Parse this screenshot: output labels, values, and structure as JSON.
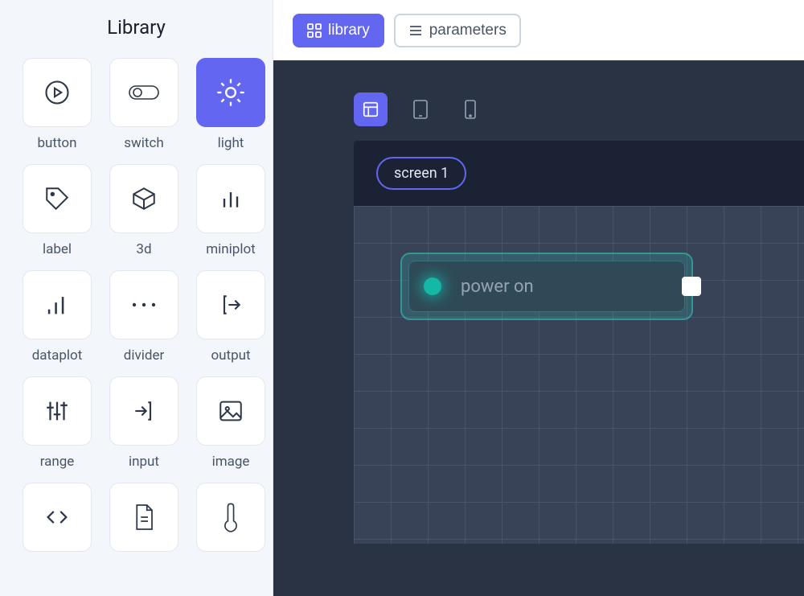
{
  "sidebar": {
    "title": "Library",
    "items": [
      {
        "key": "button",
        "label": "button",
        "selected": false
      },
      {
        "key": "switch",
        "label": "switch",
        "selected": false
      },
      {
        "key": "light",
        "label": "light",
        "selected": true
      },
      {
        "key": "label",
        "label": "label",
        "selected": false
      },
      {
        "key": "3d",
        "label": "3d",
        "selected": false
      },
      {
        "key": "miniplot",
        "label": "miniplot",
        "selected": false
      },
      {
        "key": "dataplot",
        "label": "dataplot",
        "selected": false
      },
      {
        "key": "divider",
        "label": "divider",
        "selected": false
      },
      {
        "key": "output",
        "label": "output",
        "selected": false
      },
      {
        "key": "range",
        "label": "range",
        "selected": false
      },
      {
        "key": "input",
        "label": "input",
        "selected": false
      },
      {
        "key": "image",
        "label": "image",
        "selected": false
      },
      {
        "key": "code",
        "label": "",
        "selected": false
      },
      {
        "key": "file",
        "label": "",
        "selected": false
      },
      {
        "key": "thermo",
        "label": "",
        "selected": false
      }
    ]
  },
  "topbar": {
    "tabs": [
      {
        "key": "library",
        "label": "library",
        "active": true
      },
      {
        "key": "parameters",
        "label": "parameters",
        "active": false
      }
    ]
  },
  "canvas": {
    "devices": [
      {
        "key": "desktop",
        "active": true
      },
      {
        "key": "tablet",
        "active": false
      },
      {
        "key": "mobile",
        "active": false
      }
    ],
    "screen": {
      "name": "screen 1",
      "widgets": [
        {
          "type": "light",
          "label": "power on",
          "status_color": "#14b8a6"
        }
      ]
    }
  }
}
